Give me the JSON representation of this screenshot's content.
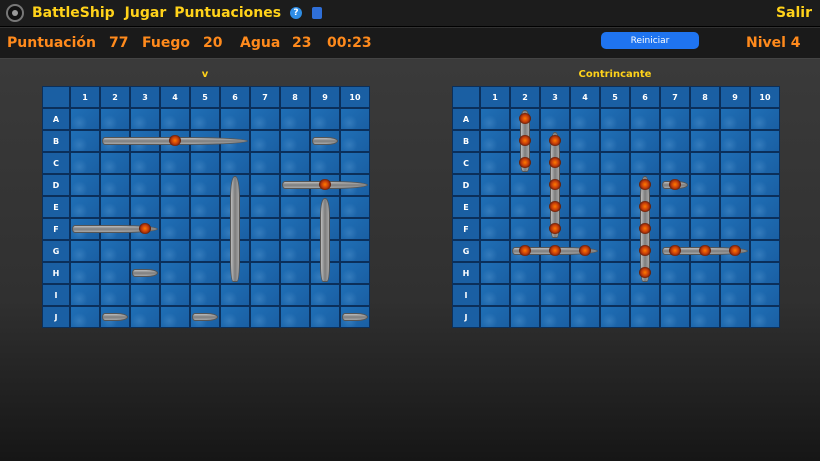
{
  "nav": {
    "brand": "BattleShip",
    "play": "Jugar",
    "scores": "Puntuaciones",
    "help_glyph": "?",
    "exit": "Salir"
  },
  "icons": {
    "logo": "ship-logo-icon",
    "help": "help-icon",
    "sound": "sound-icon"
  },
  "status": {
    "score_label": "Puntuación",
    "score_value": "77",
    "fire_label": "Fuego",
    "fire_value": "20",
    "water_label": "Agua",
    "water_value": "23",
    "time": "00:23",
    "reset_button": "Reiniciar",
    "level": "Nivel 4"
  },
  "colors": {
    "accent": "#ffd21a",
    "status": "#ff8a1c",
    "button": "#1f74f0",
    "sea": "#1a5fa3"
  },
  "grid": {
    "cols": [
      "1",
      "2",
      "3",
      "4",
      "5",
      "6",
      "7",
      "8",
      "9",
      "10"
    ],
    "rows": [
      "A",
      "B",
      "C",
      "D",
      "E",
      "F",
      "G",
      "H",
      "I",
      "J"
    ]
  },
  "boards": [
    {
      "id": "player",
      "title": "v",
      "ships": [
        {
          "row": "B",
          "col": 2,
          "len": 5,
          "dir": "h"
        },
        {
          "row": "B",
          "col": 9,
          "len": 1,
          "dir": "h"
        },
        {
          "row": "D",
          "col": 8,
          "len": 3,
          "dir": "h"
        },
        {
          "row": "D",
          "col": 6,
          "len": 5,
          "dir": "v"
        },
        {
          "row": "E",
          "col": 9,
          "len": 4,
          "dir": "v"
        },
        {
          "row": "F",
          "col": 1,
          "len": 3,
          "dir": "h"
        },
        {
          "row": "H",
          "col": 3,
          "len": 1,
          "dir": "h"
        },
        {
          "row": "J",
          "col": 2,
          "len": 1,
          "dir": "h"
        },
        {
          "row": "J",
          "col": 5,
          "len": 1,
          "dir": "h"
        },
        {
          "row": "J",
          "col": 10,
          "len": 1,
          "dir": "h"
        }
      ],
      "hits": [
        {
          "row": "B",
          "col": 4
        },
        {
          "row": "D",
          "col": 9
        },
        {
          "row": "F",
          "col": 3
        }
      ]
    },
    {
      "id": "opponent",
      "title": "Contrincante",
      "ships": [
        {
          "row": "A",
          "col": 2,
          "len": 3,
          "dir": "v"
        },
        {
          "row": "B",
          "col": 3,
          "len": 5,
          "dir": "v"
        },
        {
          "row": "D",
          "col": 6,
          "len": 5,
          "dir": "v"
        },
        {
          "row": "D",
          "col": 7,
          "len": 1,
          "dir": "h"
        },
        {
          "row": "G",
          "col": 2,
          "len": 3,
          "dir": "h"
        },
        {
          "row": "G",
          "col": 7,
          "len": 3,
          "dir": "h"
        }
      ],
      "hits": [
        {
          "row": "A",
          "col": 2
        },
        {
          "row": "B",
          "col": 2
        },
        {
          "row": "C",
          "col": 2
        },
        {
          "row": "B",
          "col": 3
        },
        {
          "row": "C",
          "col": 3
        },
        {
          "row": "D",
          "col": 3
        },
        {
          "row": "E",
          "col": 3
        },
        {
          "row": "F",
          "col": 3
        },
        {
          "row": "G",
          "col": 3
        },
        {
          "row": "D",
          "col": 6
        },
        {
          "row": "E",
          "col": 6
        },
        {
          "row": "F",
          "col": 6
        },
        {
          "row": "G",
          "col": 6
        },
        {
          "row": "H",
          "col": 6
        },
        {
          "row": "D",
          "col": 7
        },
        {
          "row": "G",
          "col": 2
        },
        {
          "row": "G",
          "col": 4
        },
        {
          "row": "G",
          "col": 7
        },
        {
          "row": "G",
          "col": 8
        },
        {
          "row": "G",
          "col": 9
        }
      ]
    }
  ]
}
